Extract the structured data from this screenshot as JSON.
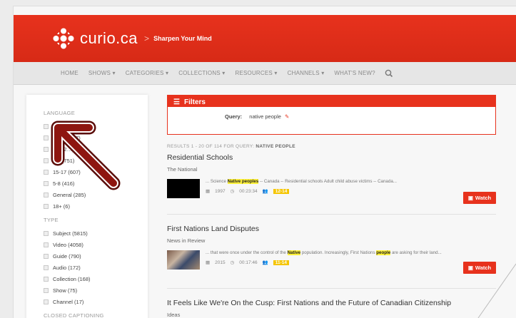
{
  "brand": {
    "logo_text": "curio.ca",
    "separator": ">",
    "tagline": "Sharpen Your Mind",
    "accent": "#e7321d"
  },
  "nav": {
    "items": [
      "HOME",
      "SHOWS ▾",
      "CATEGORIES ▾",
      "COLLECTIONS ▾",
      "RESOURCES ▾",
      "CHANNELS ▾",
      "WHAT'S NEW?"
    ],
    "search_icon": "search-icon"
  },
  "sidebar": {
    "language_heading": "LANGUAGE",
    "language_items": [
      "English (3973)",
      "French (47)"
    ],
    "age_items": [
      "-14 (2…)",
      "-12 (751)",
      "15-17 (607)",
      "5-8 (416)",
      "General (285)",
      "18+ (6)"
    ],
    "type_heading": "TYPE",
    "type_items": [
      "Subject (5815)",
      "Video (4058)",
      "Guide (790)",
      "Audio (172)",
      "Collection (168)",
      "Show (75)",
      "Channel (17)"
    ],
    "cc_heading": "CLOSED CAPTIONING"
  },
  "filters": {
    "title": "Filters",
    "query_label": "Query:",
    "query_value": "native people"
  },
  "results_summary": {
    "prefix": "RESULTS 1 - 20 OF 114 FOR QUERY:",
    "query": "NATIVE PEOPLE"
  },
  "results": [
    {
      "title": "Residential Schools",
      "subtitle": "The National",
      "snippet_before": "... Science ",
      "snippet_hl1": "Native peoples",
      "snippet_after": " -- Canada -- Residential schools Adult child abuse victims -- Canada...",
      "year": "1997",
      "duration": "00:23:34",
      "age": "12-14",
      "watch": "Watch"
    },
    {
      "title": "First Nations Land Disputes",
      "subtitle": "News in Review",
      "snippet_before": "... that were once under the control of the ",
      "snippet_hl1": "Native",
      "snippet_mid": " population. Increasingly, First Nations ",
      "snippet_hl2": "people",
      "snippet_after": " are asking for their land...",
      "year": "2015",
      "duration": "00:17:46",
      "age": "11-14",
      "watch": "Watch"
    },
    {
      "title": "It Feels Like We're On the Cusp: First Nations and the Future of Canadian Citizenship",
      "subtitle": "Ideas"
    }
  ]
}
